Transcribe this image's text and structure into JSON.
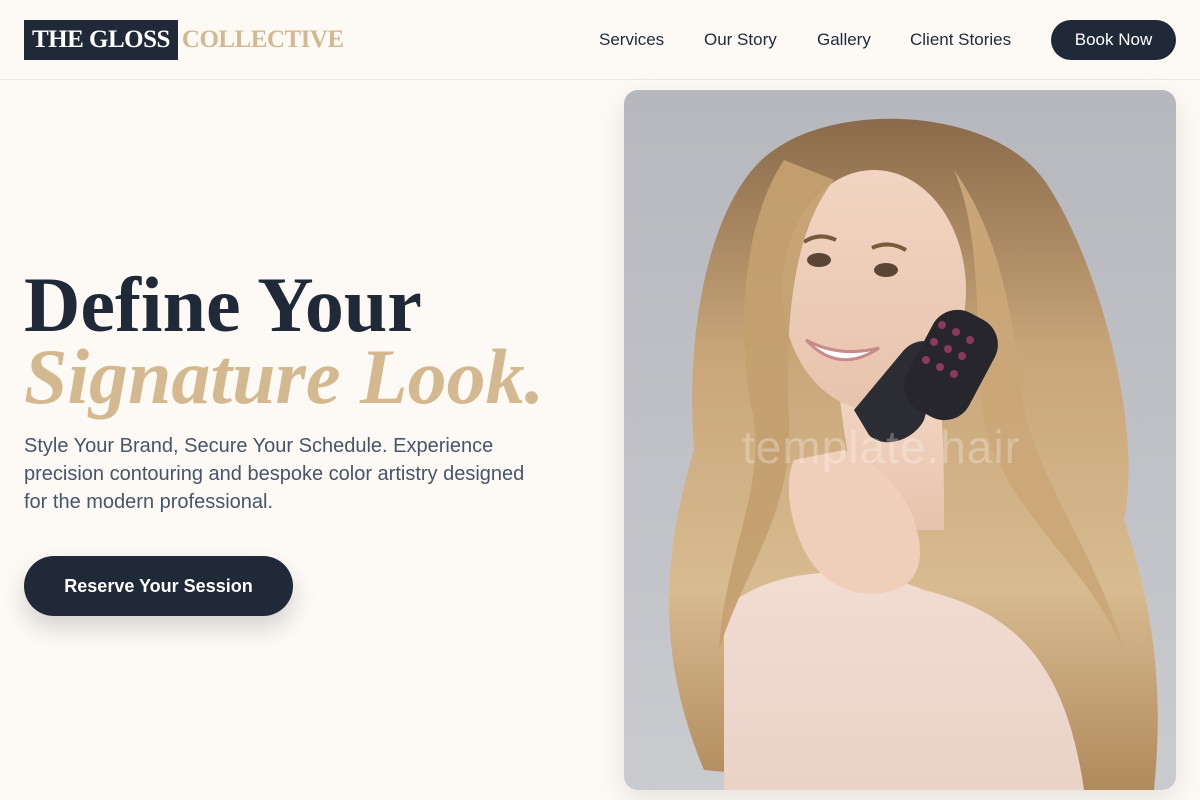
{
  "header": {
    "logo_primary": "THE GLOSS",
    "logo_secondary": "COLLECTIVE",
    "nav": [
      "Services",
      "Our Story",
      "Gallery",
      "Client Stories"
    ],
    "book_label": "Book Now"
  },
  "hero": {
    "headline_line1": "Define Your",
    "headline_line2": "Signature Look.",
    "subtext": "Style Your Brand, Secure Your Schedule. Experience precision contouring and bespoke color artistry designed for the modern professional.",
    "cta_label": "Reserve Your Session",
    "image_watermark": "template.hair"
  },
  "colors": {
    "background": "#fdf9f4",
    "navy": "#1f2937",
    "gold": "#d4b990",
    "body_text": "#475569"
  },
  "icons": {
    "hero_image": "woman-with-hair-brush-photo"
  }
}
